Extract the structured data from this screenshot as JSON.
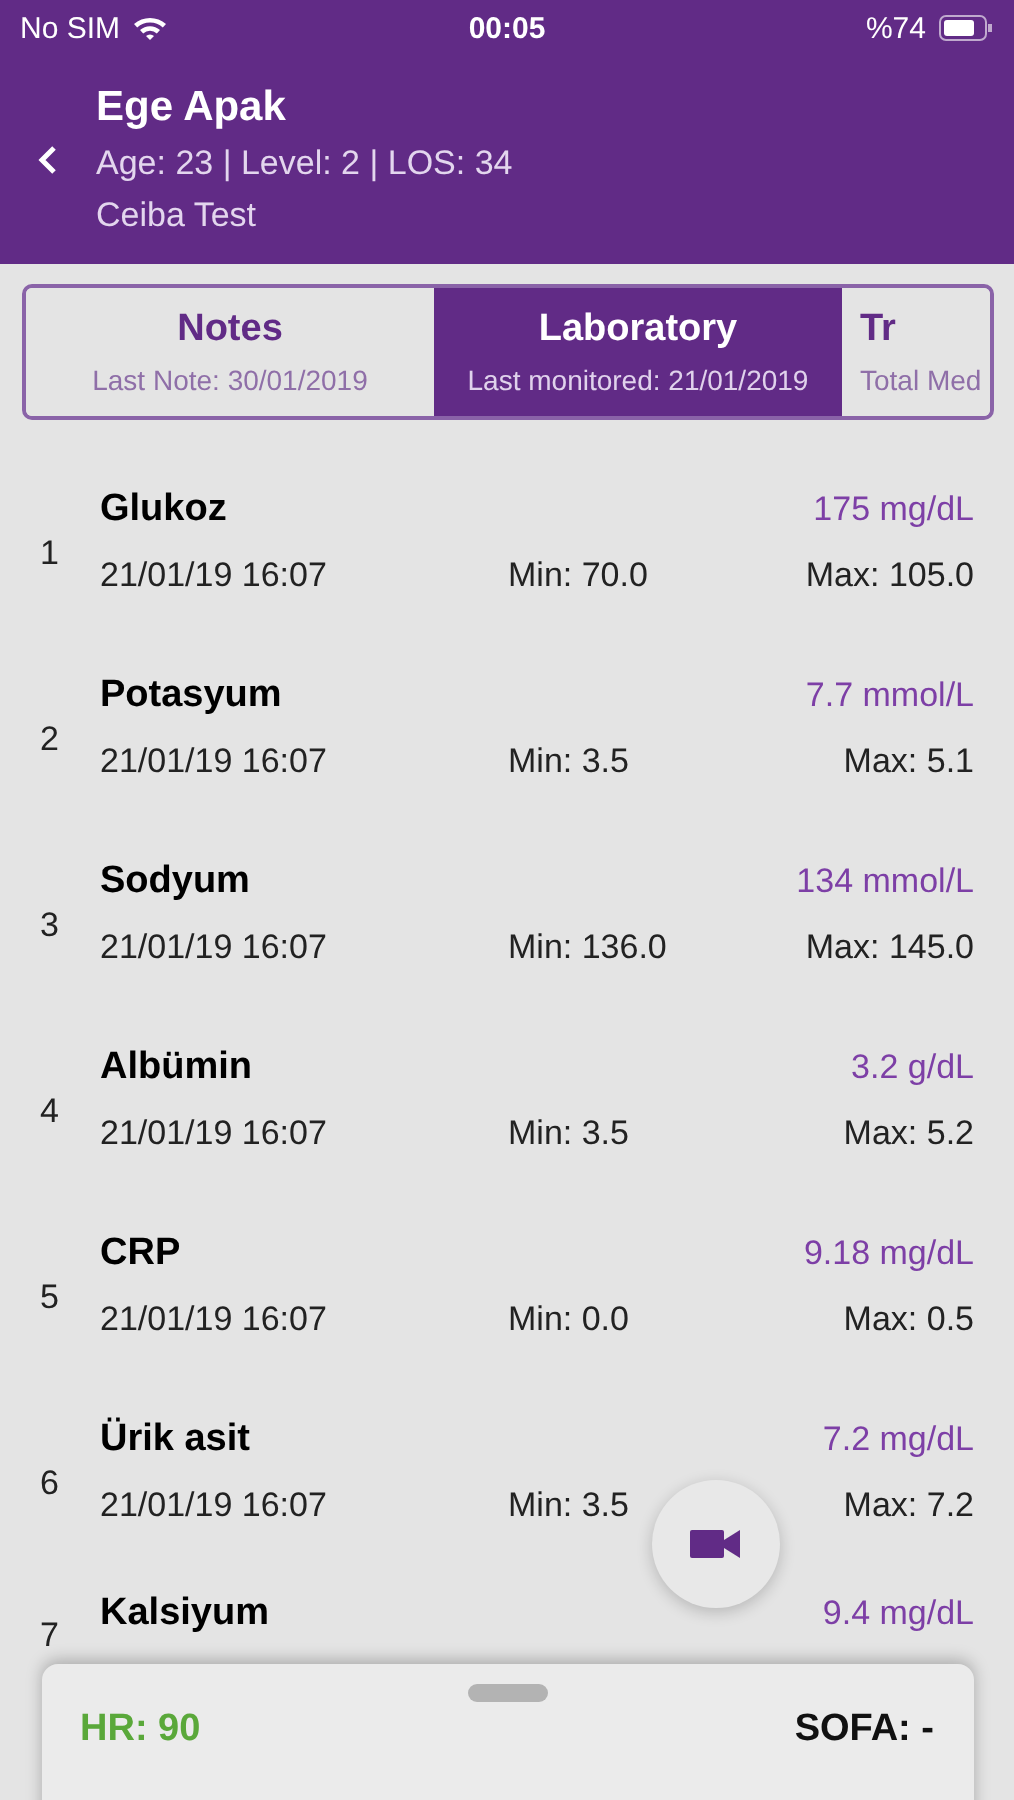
{
  "status_bar": {
    "carrier": "No SIM",
    "time": "00:05",
    "battery": "%74"
  },
  "patient": {
    "name": "Ege Apak",
    "details": "Age: 23 | Level: 2 | LOS: 34",
    "unit": "Ceiba Test"
  },
  "tabs": [
    {
      "label": "Notes",
      "sublabel": "Last Note: 30/01/2019",
      "selected": false
    },
    {
      "label": "Laboratory",
      "sublabel": "Last monitored: 21/01/2019",
      "selected": true
    },
    {
      "label": "Tr",
      "sublabel": "Total Med",
      "selected": false
    }
  ],
  "lab_results": [
    {
      "index": "1",
      "name": "Glukoz",
      "value": "175 mg/dL",
      "date": "21/01/19 16:07",
      "min": "Min: 70.0",
      "max": "Max: 105.0"
    },
    {
      "index": "2",
      "name": "Potasyum",
      "value": "7.7 mmol/L",
      "date": "21/01/19 16:07",
      "min": "Min: 3.5",
      "max": "Max: 5.1"
    },
    {
      "index": "3",
      "name": "Sodyum",
      "value": "134 mmol/L",
      "date": "21/01/19 16:07",
      "min": "Min: 136.0",
      "max": "Max: 145.0"
    },
    {
      "index": "4",
      "name": "Albümin",
      "value": "3.2 g/dL",
      "date": "21/01/19 16:07",
      "min": "Min: 3.5",
      "max": "Max: 5.2"
    },
    {
      "index": "5",
      "name": "CRP",
      "value": "9.18 mg/dL",
      "date": "21/01/19 16:07",
      "min": "Min: 0.0",
      "max": "Max: 0.5"
    },
    {
      "index": "6",
      "name": "Ürik asit",
      "value": "7.2 mg/dL",
      "date": "21/01/19 16:07",
      "min": "Min: 3.5",
      "max": "Max: 7.2"
    },
    {
      "index": "7",
      "name": "Kalsiyum",
      "value": "9.4 mg/dL"
    }
  ],
  "bottom_sheet": {
    "heart_rate": "HR: 90",
    "sofa": "SOFA: -"
  }
}
